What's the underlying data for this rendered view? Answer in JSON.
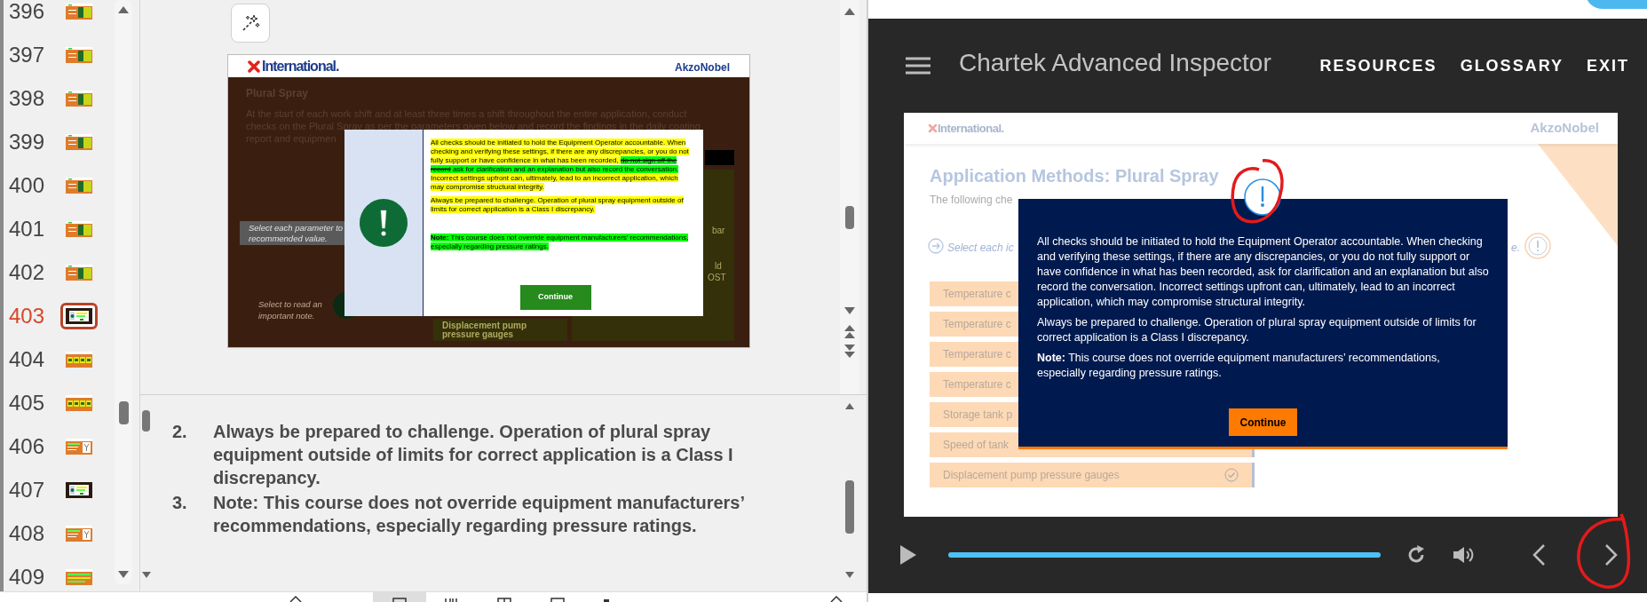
{
  "thumbnails": [
    {
      "number": "396",
      "selected": false,
      "kind": "orange-green"
    },
    {
      "number": "397",
      "selected": false,
      "kind": "orange-green"
    },
    {
      "number": "398",
      "selected": false,
      "kind": "orange-green"
    },
    {
      "number": "399",
      "selected": false,
      "kind": "orange-green"
    },
    {
      "number": "400",
      "selected": false,
      "kind": "orange-green"
    },
    {
      "number": "401",
      "selected": false,
      "kind": "orange-green"
    },
    {
      "number": "402",
      "selected": false,
      "kind": "orange-green"
    },
    {
      "number": "403",
      "selected": true,
      "kind": "dark"
    },
    {
      "number": "404",
      "selected": false,
      "kind": "orange-tiles"
    },
    {
      "number": "405",
      "selected": false,
      "kind": "orange-tiles"
    },
    {
      "number": "406",
      "selected": false,
      "kind": "orange-white"
    },
    {
      "number": "407",
      "selected": false,
      "kind": "dark"
    },
    {
      "number": "408",
      "selected": false,
      "kind": "orange-white"
    },
    {
      "number": "409",
      "selected": false,
      "kind": "orange-bars"
    }
  ],
  "editor_slide": {
    "logo": "International.",
    "brand": "AkzoNobel",
    "heading": "Plural Spray",
    "intro_lines": [
      "At the start of each work shift and at least three times a shift throughout the entire application, conduct",
      "checks on the Plural Spray as per the parameters given below and record the findings in the daily coating",
      "report and equipmen"
    ],
    "instruction_lines": [
      "Select each parameter to",
      "recommended value."
    ],
    "note_hint_lines": [
      "Select to read an",
      "important note."
    ],
    "peek_texts": [
      "bar",
      "ld",
      "OST"
    ],
    "item": "Displacement pump pressure gauges",
    "dialog": {
      "paragraphs": [
        [
          {
            "text": "All checks should be initiated to hold the Equipment Operator accountable. When checking and verifying these settings, if there are any discrepancies, or you do not fully support or have confidence in what has been recorded, ",
            "color": "#ffff00",
            "struck": false
          },
          {
            "text": "do not sign off the record",
            "color": "#00ff00",
            "struck": true
          },
          {
            "text": " ask for clarification and an explanation but also record the conversation.",
            "color": "#00ff00",
            "struck": false
          },
          {
            "text": " Incorrect settings upfront can, ultimately, lead to an incorrect application, which may compromise structural integrity.",
            "color": "#ffff00",
            "struck": false
          }
        ],
        [
          {
            "text": "Always be prepared to challenge. Operation of plural spray equipment outside of limits for correct application is a Class I discrepancy.",
            "color": "#ffff00",
            "struck": false
          }
        ],
        [
          {
            "text": "**Note:** This course does not override equipment manufacturers’ recommendations, especially regarding pressure ratings.",
            "color": "#00ff00",
            "struck": false
          }
        ]
      ],
      "button": "Continue"
    }
  },
  "notes": [
    {
      "number": "2.",
      "text": "Always be prepared to challenge. Operation of plural spray equipment outside of limits for correct application is a Class I discrepancy."
    },
    {
      "number": "3.",
      "text": "Note: This course does not override equipment manufacturers’ recommendations, especially regarding pressure ratings."
    }
  ],
  "player": {
    "title": "Chartek Advanced Inspector",
    "nav": [
      "RESOURCES",
      "GLOSSARY",
      "EXIT"
    ],
    "slide": {
      "logo": "International.",
      "brand": "AkzoNobel",
      "heading": "Application Methods: Plural Spray",
      "intro": "The following che",
      "instruction_start": "Select each ic",
      "instruction_end": "e.",
      "items": [
        {
          "label": "Temperature c",
          "checked": false
        },
        {
          "label": "Temperature c",
          "checked": false
        },
        {
          "label": "Temperature c",
          "checked": false
        },
        {
          "label": "Temperature c",
          "checked": false
        },
        {
          "label": "Storage tank p",
          "checked": false
        },
        {
          "label": "Speed of tank",
          "checked": false
        },
        {
          "label": "Displacement pump pressure gauges",
          "checked": true
        }
      ],
      "dialog": {
        "paragraphs": [
          "All checks should be initiated to hold the Equipment Operator accountable. When checking and verifying these settings, if there are any discrepancies, or you do not fully support or have confidence in what has been recorded, ask for clarification and an explanation but also record the conversation. Incorrect settings upfront can, ultimately, lead to an incorrect application, which may compromise structural integrity.",
          "Always be prepared to challenge. Operation of plural spray equipment outside of limits for correct application is a Class I discrepancy.",
          "**Note:** This course does not override equipment manufacturers’ recommendations, especially regarding pressure ratings."
        ],
        "button": "Continue"
      }
    }
  }
}
